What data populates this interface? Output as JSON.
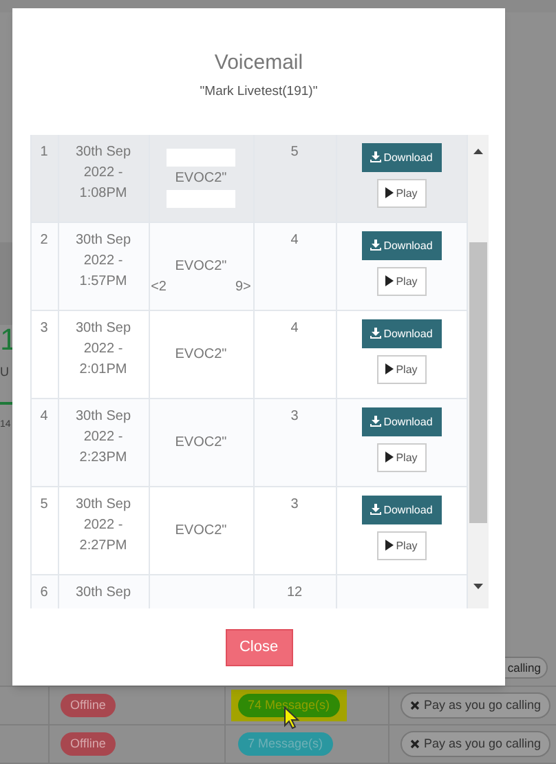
{
  "backdrop": {
    "side_texts": [
      {
        "kind": "big",
        "text": "1"
      },
      {
        "kind": "label",
        "text": "U"
      },
      {
        "kind": "small",
        "text": "14"
      }
    ],
    "partial_plan": "calling",
    "rows": [
      {
        "status": "Offline",
        "messages": "74 Message(s)",
        "color": "#2f8a06",
        "highlighted": true,
        "plan": "Pay as you go calling"
      },
      {
        "status": "Offline",
        "messages": "7 Message(s)",
        "color": "#2a97a0",
        "highlighted": false,
        "plan": "Pay as you go calling"
      }
    ]
  },
  "modal": {
    "title": "Voicemail",
    "subtitle": "\"Mark Livetest(191)\"",
    "rows": [
      {
        "index": "1",
        "date": [
          "30th Sep",
          "2022 -",
          "1:08PM"
        ],
        "highlighted": true,
        "caller_lines": [
          [
            {
              "kind": "redacted"
            }
          ],
          [
            {
              "kind": "text",
              "text": "EVOC2\""
            }
          ],
          [
            {
              "kind": "redacted"
            }
          ]
        ],
        "duration": "5",
        "actions": [
          {
            "kind": "download",
            "label": "Download"
          },
          {
            "kind": "play",
            "label": "Play"
          }
        ]
      },
      {
        "index": "2",
        "date": [
          "30th Sep",
          "2022 -",
          "1:57PM"
        ],
        "highlighted": false,
        "caller_lines": [
          [
            {
              "kind": "blank"
            }
          ],
          [
            {
              "kind": "text",
              "text": "EVOC2\""
            }
          ],
          [
            {
              "kind": "text",
              "text": "<2"
            },
            {
              "kind": "blank"
            },
            {
              "kind": "text",
              "text": "9>"
            }
          ]
        ],
        "duration": "4",
        "actions": [
          {
            "kind": "download",
            "label": "Download"
          },
          {
            "kind": "play",
            "label": "Play"
          }
        ]
      },
      {
        "index": "3",
        "date": [
          "30th Sep",
          "2022 -",
          "2:01PM"
        ],
        "highlighted": false,
        "caller_lines": [
          [
            {
              "kind": "text",
              "text": "EVOC2\""
            }
          ]
        ],
        "duration": "4",
        "actions": [
          {
            "kind": "download",
            "label": "Download"
          },
          {
            "kind": "play",
            "label": "Play"
          }
        ]
      },
      {
        "index": "4",
        "date": [
          "30th Sep",
          "2022 -",
          "2:23PM"
        ],
        "highlighted": false,
        "caller_lines": [
          [
            {
              "kind": "blank"
            }
          ],
          [
            {
              "kind": "text",
              "text": "EVOC2\""
            }
          ],
          [
            {
              "kind": "blank"
            }
          ]
        ],
        "duration": "3",
        "actions": [
          {
            "kind": "download",
            "label": "Download"
          },
          {
            "kind": "play",
            "label": "Play"
          }
        ]
      },
      {
        "index": "5",
        "date": [
          "30th Sep",
          "2022 -",
          "2:27PM"
        ],
        "highlighted": false,
        "caller_lines": [
          [
            {
              "kind": "text",
              "text": "EVOC2\""
            }
          ]
        ],
        "duration": "3",
        "actions": [
          {
            "kind": "download",
            "label": "Download"
          },
          {
            "kind": "play",
            "label": "Play"
          }
        ]
      },
      {
        "index": "6",
        "date": [
          "30th Sep"
        ],
        "highlighted": false,
        "duration": "12",
        "actions": []
      }
    ],
    "close": "Close"
  }
}
